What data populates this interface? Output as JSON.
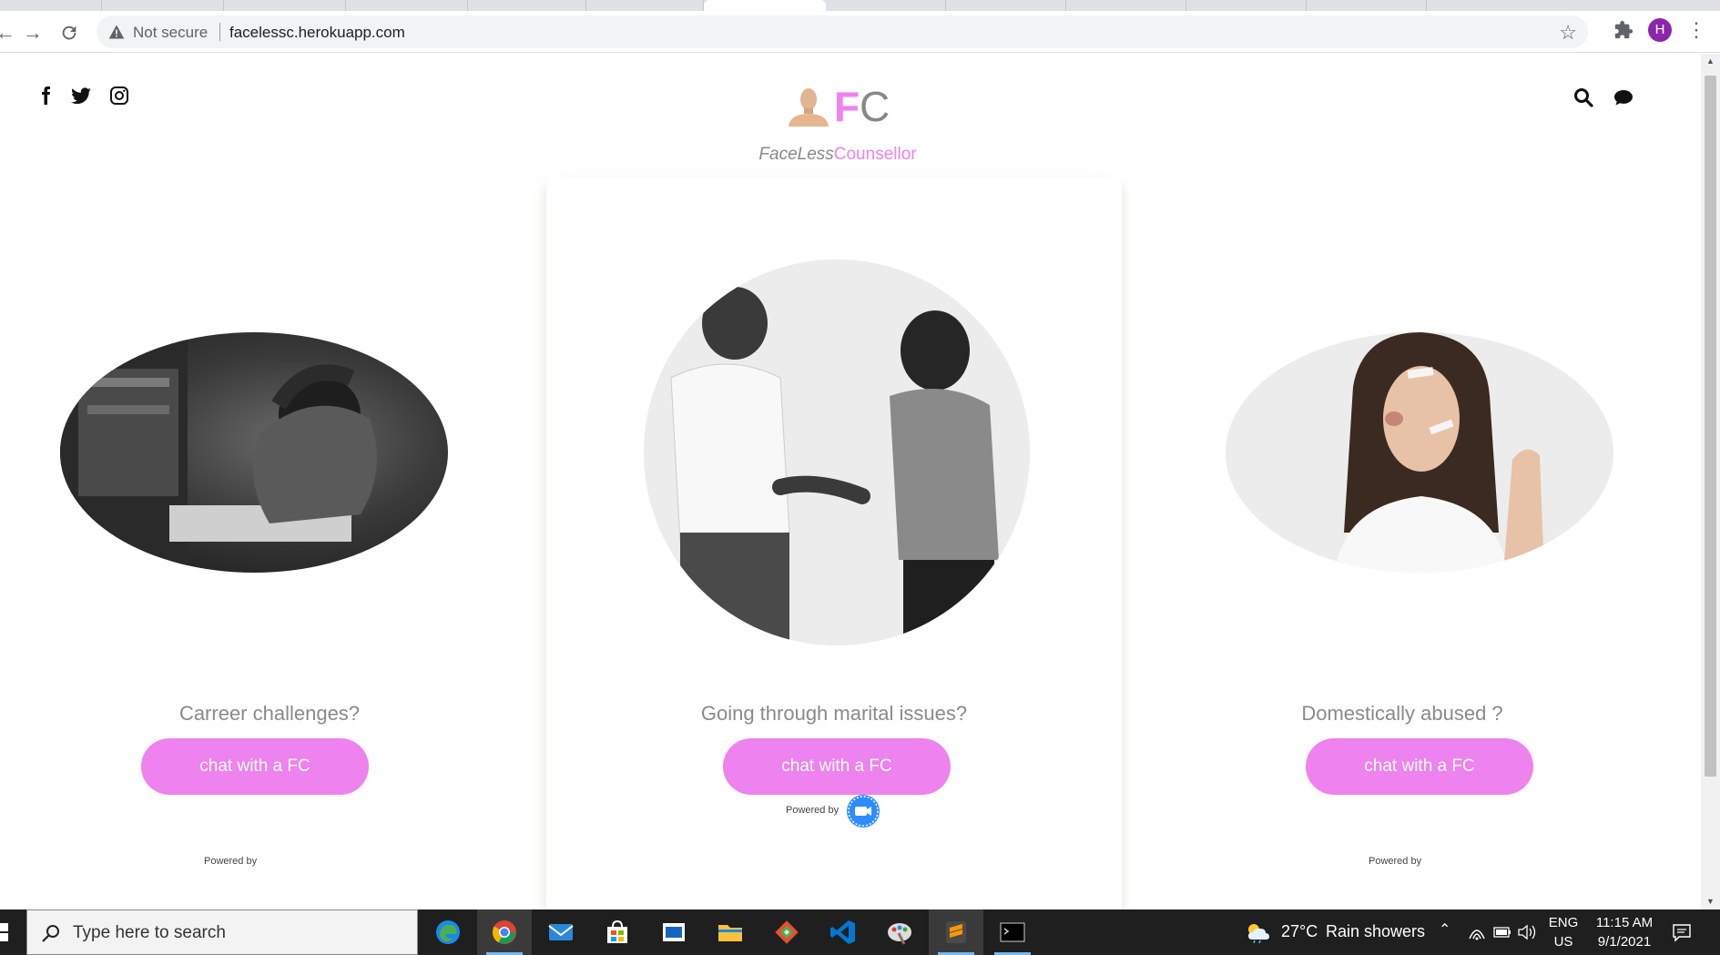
{
  "browser": {
    "security_label": "Not secure",
    "url": "facelessc.herokuapp.com",
    "profile_initial": "H"
  },
  "header": {
    "logo_f": "F",
    "logo_c": "C",
    "tagline_part1": "FaceLess",
    "tagline_part2": "Counsellor",
    "social_icons": [
      "facebook-icon",
      "twitter-icon",
      "instagram-icon"
    ],
    "right_icons": [
      "search-icon",
      "chat-icon"
    ]
  },
  "cards": [
    {
      "question": "Carreer challenges?",
      "button": "chat with a FC",
      "powered": "Powered by"
    },
    {
      "question": "Going through marital issues?",
      "button": "chat with a FC",
      "powered": "Powered by"
    },
    {
      "question": "Domestically abused ?",
      "button": "chat with a FC",
      "powered": "Powered by"
    }
  ],
  "taskbar": {
    "search_placeholder": "Type here to search",
    "weather_temp": "27°C",
    "weather_desc": "Rain showers",
    "lang": "ENG",
    "region": "US",
    "time": "11:15 AM",
    "date": "9/1/2021"
  },
  "colors": {
    "brand_pink": "#ee82ee",
    "profile_purple": "#8e24aa",
    "taskbar": "#1f1f1f"
  }
}
